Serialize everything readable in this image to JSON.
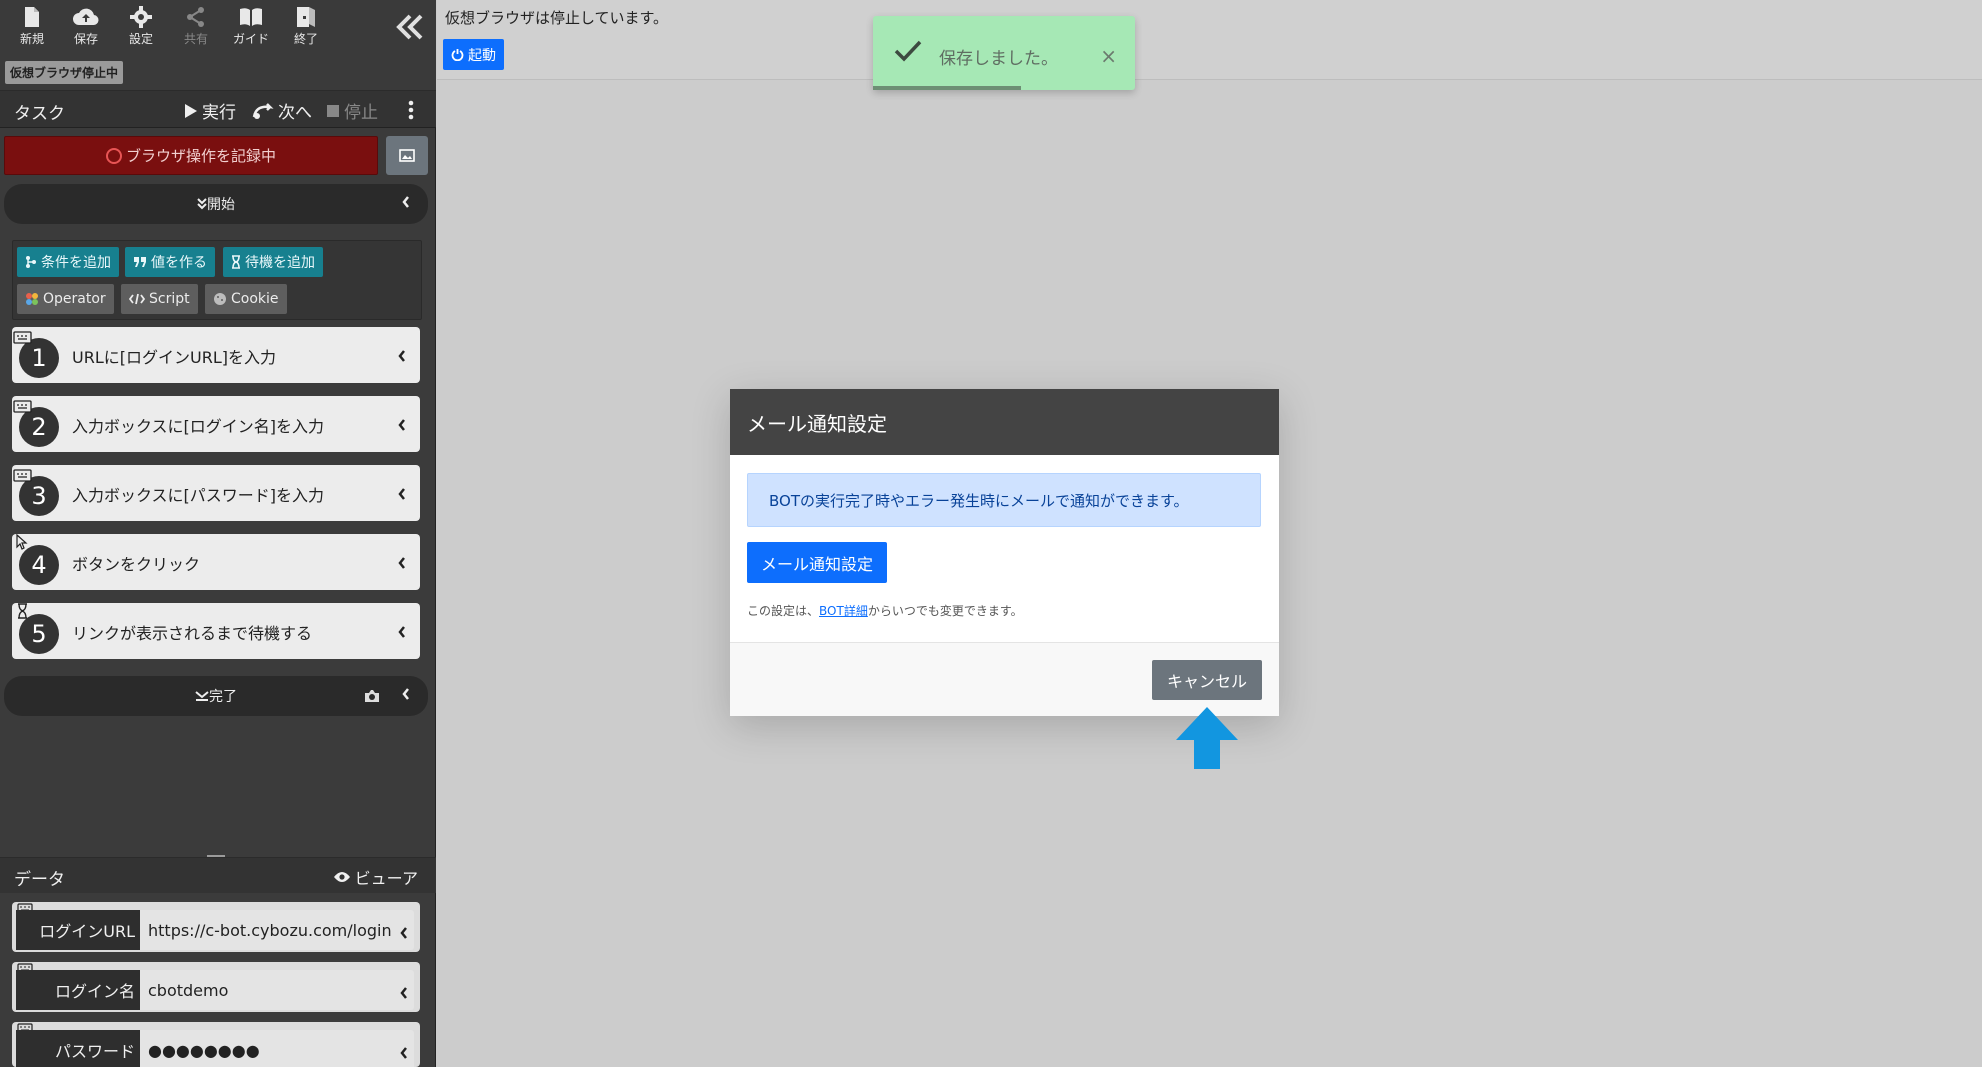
{
  "toolbar": {
    "new": "新規",
    "save": "保存",
    "settings": "設定",
    "share": "共有",
    "guide": "ガイド",
    "exit": "終了",
    "vm_badge": "仮想ブラウザ停止中"
  },
  "task": {
    "title": "タスク",
    "run": "実行",
    "next": "次へ",
    "stop": "停止",
    "recording": "ブラウザ操作を記録中",
    "start": "開始",
    "end": "完了"
  },
  "tools": {
    "add_condition": "条件を追加",
    "make_value": "値を作る",
    "add_wait": "待機を追加",
    "operator": "Operator",
    "script": "Script",
    "cookie": "Cookie"
  },
  "steps": [
    {
      "num": "1",
      "text": "URLに[ログインURL]を入力",
      "kind": "keyboard-icon"
    },
    {
      "num": "2",
      "text": "入力ボックスに[ログイン名]を入力",
      "kind": "keyboard-icon"
    },
    {
      "num": "3",
      "text": "入力ボックスに[パスワード]を入力",
      "kind": "keyboard-icon"
    },
    {
      "num": "4",
      "text": "ボタンをクリック",
      "kind": "cursor-icon"
    },
    {
      "num": "5",
      "text": "リンクが表示されるまで待機する",
      "kind": "hourglass-icon"
    }
  ],
  "data": {
    "title": "データ",
    "viewer": "ビューア",
    "rows": [
      {
        "key": "ログインURL",
        "value": "https://c-bot.cybozu.com/login"
      },
      {
        "key": "ログイン名",
        "value": "cbotdemo"
      },
      {
        "key": "パスワード",
        "value": "●●●●●●●●"
      }
    ]
  },
  "main": {
    "status": "仮想ブラウザは停止しています。",
    "start_button": "起動"
  },
  "toast": {
    "message": "保存しました。",
    "close": "×"
  },
  "modal": {
    "title": "メール通知設定",
    "info": "BOTの実行完了時やエラー発生時にメールで通知ができます。",
    "primary_button": "メール通知設定",
    "note_before": "この設定は、",
    "note_link": "BOT詳細",
    "note_after": "からいつでも変更できます。",
    "cancel_button": "キャンセル"
  },
  "colors": {
    "recording": "#7a0f0f",
    "teal": "#17808f",
    "primary": "#0d6efd",
    "toast": "#a6e8b5",
    "hint_arrow": "#1296e0"
  }
}
